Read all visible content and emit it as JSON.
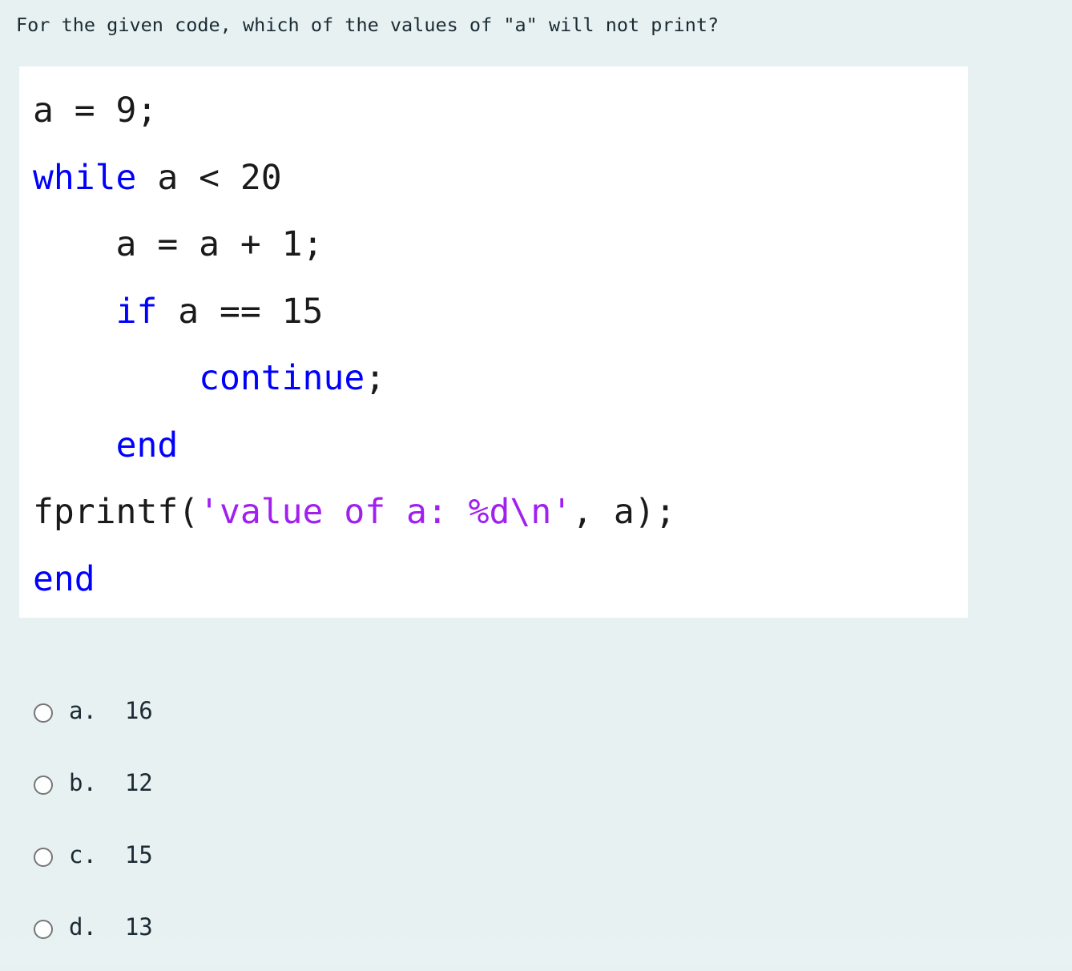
{
  "page": {
    "background_color": "#e7f1f2",
    "text_color": "#1b2b33"
  },
  "question": {
    "prompt": "For the given code, which of the values of \"a\" will not print?"
  },
  "code_block": {
    "background_color": "#ffffff",
    "keyword_color": "#0000ff",
    "string_color": "#a020f0",
    "plain_color": "#1a1a1a",
    "language": "MATLAB",
    "lines": [
      {
        "id": "line-1",
        "text": "a = 9;",
        "segments": [
          {
            "t": "a = 9;",
            "c": "plain"
          }
        ]
      },
      {
        "id": "line-2",
        "text": "while a < 20",
        "segments": [
          {
            "t": "while",
            "c": "kw"
          },
          {
            "t": " a < 20",
            "c": "plain"
          }
        ]
      },
      {
        "id": "line-3",
        "text": "    a = a + 1;",
        "segments": [
          {
            "t": "    a = a + 1;",
            "c": "plain"
          }
        ]
      },
      {
        "id": "line-4",
        "text": "    if a == 15",
        "segments": [
          {
            "t": "    ",
            "c": "plain"
          },
          {
            "t": "if",
            "c": "kw"
          },
          {
            "t": " a == 15",
            "c": "plain"
          }
        ]
      },
      {
        "id": "line-5",
        "text": "        continue;",
        "segments": [
          {
            "t": "        ",
            "c": "plain"
          },
          {
            "t": "continue",
            "c": "kw"
          },
          {
            "t": ";",
            "c": "plain"
          }
        ]
      },
      {
        "id": "line-6",
        "text": "    end",
        "segments": [
          {
            "t": "    ",
            "c": "plain"
          },
          {
            "t": "end",
            "c": "kw"
          }
        ]
      },
      {
        "id": "line-7",
        "text": "fprintf('value of a: %d\\n', a);",
        "segments": [
          {
            "t": "fprintf(",
            "c": "plain"
          },
          {
            "t": "'value of a: %d\\n'",
            "c": "str"
          },
          {
            "t": ", a);",
            "c": "plain"
          }
        ]
      },
      {
        "id": "line-8",
        "text": "end",
        "segments": [
          {
            "t": "end",
            "c": "kw"
          }
        ]
      }
    ]
  },
  "answers": {
    "selected": null,
    "radio_border_color": "#767676",
    "options": [
      {
        "key": "a",
        "label": "a.  16",
        "value": "16"
      },
      {
        "key": "b",
        "label": "b.  12",
        "value": "12"
      },
      {
        "key": "c",
        "label": "c.  15",
        "value": "15"
      },
      {
        "key": "d",
        "label": "d.  13",
        "value": "13"
      }
    ]
  }
}
